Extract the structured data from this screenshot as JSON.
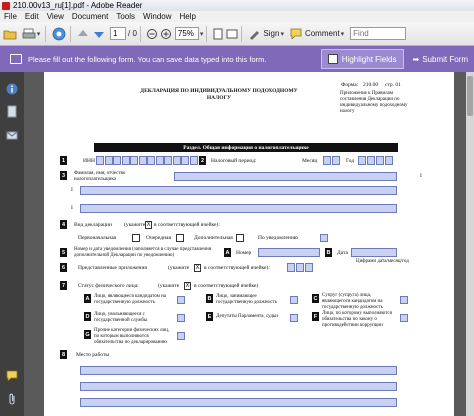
{
  "window": {
    "title": "210.00v13_ru[1].pdf - Adobe Reader"
  },
  "menu": [
    "File",
    "Edit",
    "View",
    "Document",
    "Tools",
    "Window",
    "Help"
  ],
  "toolbar": {
    "page_current": "1",
    "page_total": "/ 0",
    "zoom": "75%",
    "sign_label": "Sign",
    "comment_label": "Comment",
    "find_placeholder": "Find"
  },
  "formbar": {
    "message": "Please fill out the following form. You can save data typed into this form.",
    "highlight_label": "Highlight Fields",
    "submit_label": "Submit Form"
  },
  "document": {
    "title": "ДЕКЛАРАЦИЯ ПО ИНДИВИДУАЛЬНОМУ ПОДОХОДНОМУ НАЛОГУ",
    "form_label": "Форма:",
    "form_no": "210.00",
    "page_label": "стр. 01",
    "appendix": "Приложение к Правилам составления Декларации по индивидуальному подоходному налогу",
    "section_header": "Раздел. Общая информация о налогоплательщике",
    "inn_label": "ИНН",
    "tax_period_label": "Налоговый период:",
    "month_label": "Месяц",
    "year_label": "Год",
    "fio_label": "Фамилия, имя, отчество налогоплательщика",
    "decl_type_label": "Вид декларации",
    "decl_type_hint": "(укажите",
    "decl_type_hint2": "в соответствующей ячейке):",
    "x_mark": "X",
    "types": [
      "Первоначальная",
      "Очередная",
      "Дополнительная",
      "По уведомлению"
    ],
    "notice_label": "Номер и дата уведомления (заполняется в случае представления дополнительной Декларации по уведомлению)",
    "letter_a": "A",
    "number_label": "Номер",
    "letter_b": "B",
    "date_label": "Дата",
    "digits_label": "Цифрами дата/месяц/год",
    "appendices_label": "Представленные приложения",
    "appendices_hint": "(укажите",
    "appendices_hint2": "в соответствующей ячейке):",
    "status_label": "Статус физического лица:",
    "status_hint": "(укажите",
    "status_hint2": "в соответствующей ячейке)",
    "status_options": [
      {
        "letter": "A",
        "text": "Лицо, являющееся кандидатом на государственную должность"
      },
      {
        "letter": "B",
        "text": "Лицо, занимающее государственную должность"
      },
      {
        "letter": "C",
        "text": "Супруг (супруга) лица, являющегося кандидатом на государственную должность"
      },
      {
        "letter": "D",
        "text": "Лицо, увольняющееся с государственной службы"
      },
      {
        "letter": "E",
        "text": "Депутаты Парламента, судьи"
      },
      {
        "letter": "F",
        "text": "Лицо, по которому выполняются обязательства по закону о противодействии коррупции"
      },
      {
        "letter": "G",
        "text": "Прочие категории физических лиц, по которым выполняются обязательства по декларированию"
      }
    ],
    "row_numbers": [
      "1",
      "2",
      "3",
      "4",
      "5",
      "6",
      "7",
      "8"
    ],
    "workplace_label": "Место работы",
    "sub_markers": [
      "I",
      "I",
      "I"
    ]
  }
}
